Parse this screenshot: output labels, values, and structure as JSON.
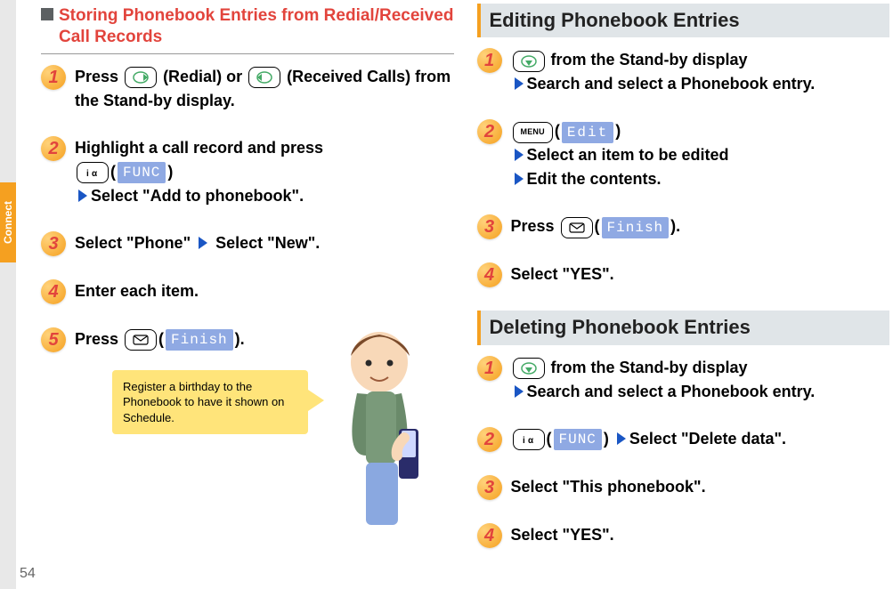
{
  "sidebar": {
    "label": "Connect"
  },
  "page_number": "54",
  "left": {
    "heading": "Storing Phonebook Entries from Redial/Received Call Records",
    "steps": {
      "1": {
        "pre": "Press ",
        "a": "(Redial) or ",
        "b": "(Received Calls) from the Stand-by display."
      },
      "2": {
        "a": "Highlight a call record and press ",
        "func": "FUNC",
        "b": "Select \"Add to phonebook\"."
      },
      "3": {
        "a": "Select \"Phone\"",
        "b": "Select \"New\"."
      },
      "4": {
        "a": "Enter each item."
      },
      "5": {
        "a": "Press ",
        "finish": "Finish",
        "b": "."
      }
    },
    "callout": "Register a birthday to the Phonebook to have it shown on Schedule."
  },
  "right": {
    "edit": {
      "heading": "Editing Phonebook Entries",
      "steps": {
        "1": {
          "a": " from the Stand-by display",
          "b": "Search and select a Phonebook entry."
        },
        "2": {
          "edit": "Edit",
          "a": "Select an item to be edited",
          "b": "Edit the contents."
        },
        "3": {
          "a": "Press ",
          "finish": "Finish",
          "b": "."
        },
        "4": {
          "a": "Select \"YES\"."
        }
      }
    },
    "del": {
      "heading": "Deleting Phonebook Entries",
      "steps": {
        "1": {
          "a": " from the Stand-by display",
          "b": "Search and select a Phonebook entry."
        },
        "2": {
          "func": "FUNC",
          "a": "Select \"Delete data\"."
        },
        "3": {
          "a": "Select \"This phonebook\"."
        },
        "4": {
          "a": "Select \"YES\"."
        }
      }
    }
  }
}
